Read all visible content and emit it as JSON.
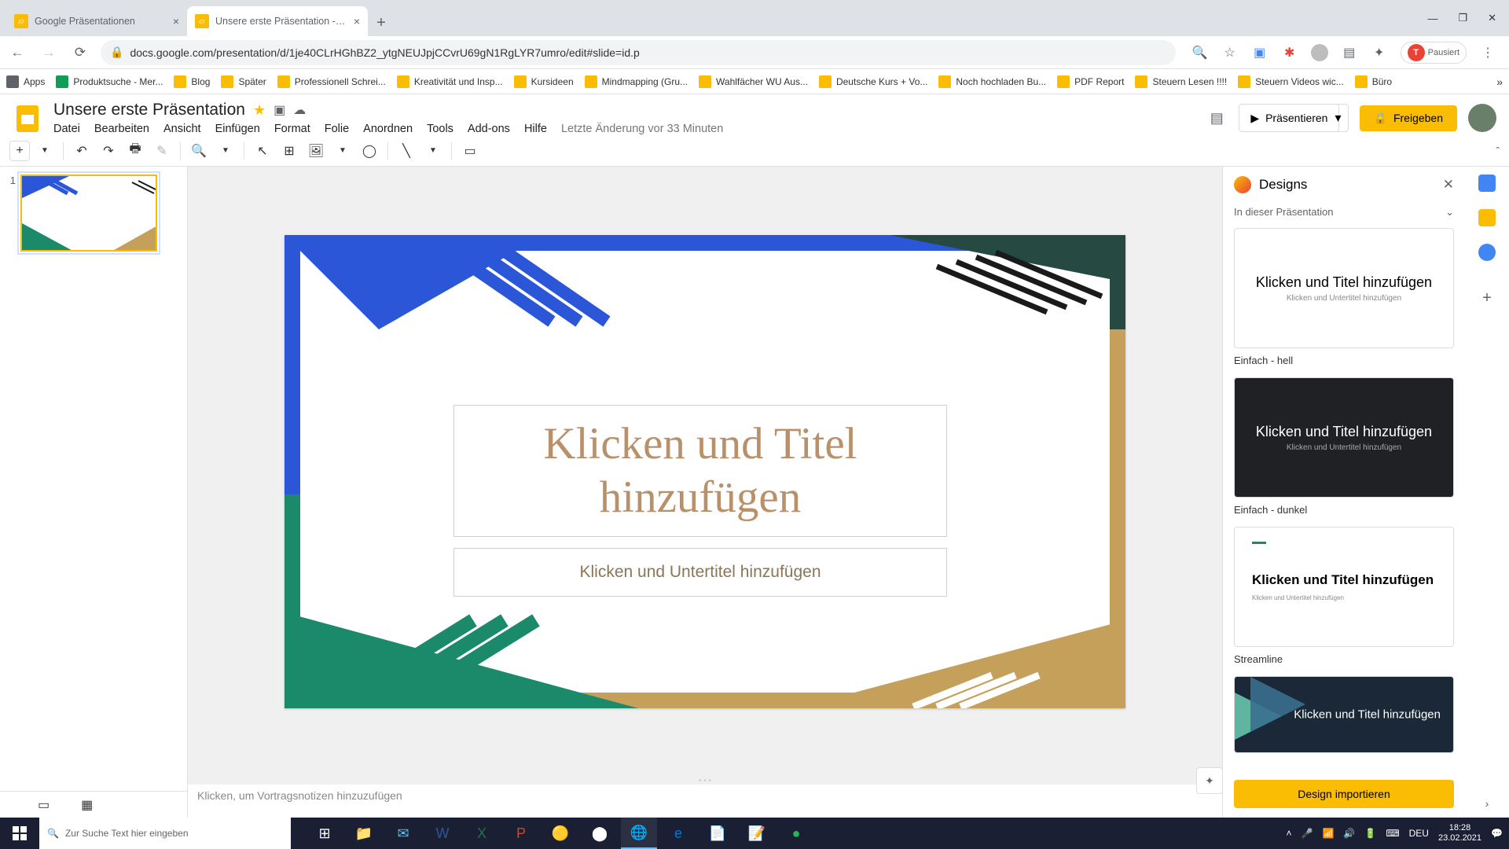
{
  "browser": {
    "tabs": [
      {
        "title": "Google Präsentationen"
      },
      {
        "title": "Unsere erste Präsentation - Goo..."
      }
    ],
    "url": "docs.google.com/presentation/d/1je40CLrHGhBZ2_ytgNEUJpjCCvrU69gN1RgLYR7umro/edit#slide=id.p",
    "pause_label": "Pausiert",
    "pause_initial": "T"
  },
  "bookmarks": [
    "Apps",
    "Produktsuche - Mer...",
    "Blog",
    "Später",
    "Professionell Schrei...",
    "Kreativität und Insp...",
    "Kursideen",
    "Mindmapping (Gru...",
    "Wahlfächer WU Aus...",
    "Deutsche Kurs + Vo...",
    "Noch hochladen Bu...",
    "PDF Report",
    "Steuern Lesen !!!!",
    "Steuern Videos wic...",
    "Büro"
  ],
  "app": {
    "doc_title": "Unsere erste Präsentation",
    "menus": [
      "Datei",
      "Bearbeiten",
      "Ansicht",
      "Einfügen",
      "Format",
      "Folie",
      "Anordnen",
      "Tools",
      "Add-ons",
      "Hilfe"
    ],
    "last_edit": "Letzte Änderung vor 33 Minuten",
    "present": "Präsentieren",
    "share": "Freigeben"
  },
  "slide": {
    "number": "1",
    "title_ph": "Klicken und Titel hinzufügen",
    "subtitle_ph": "Klicken und Untertitel hinzufügen",
    "notes_ph": "Klicken, um Vortragsnotizen hinzuzufügen"
  },
  "designs": {
    "panel_title": "Designs",
    "section": "In dieser Präsentation",
    "themes": [
      {
        "title": "Klicken und Titel hinzufügen",
        "sub": "Klicken und Untertitel hinzufügen",
        "label": "Einfach - hell"
      },
      {
        "title": "Klicken und Titel hinzufügen",
        "sub": "Klicken und Untertitel hinzufügen",
        "label": "Einfach - dunkel"
      },
      {
        "title": "Klicken und Titel hinzufügen",
        "sub": "Klicken und Untertitel hinzufügen",
        "label": "Streamline"
      },
      {
        "title": "Klicken und Titel hinzufügen",
        "sub": ""
      }
    ],
    "import": "Design importieren"
  },
  "taskbar": {
    "search_ph": "Zur Suche Text hier eingeben",
    "lang": "DEU",
    "time": "18:28",
    "date": "23.02.2021"
  }
}
